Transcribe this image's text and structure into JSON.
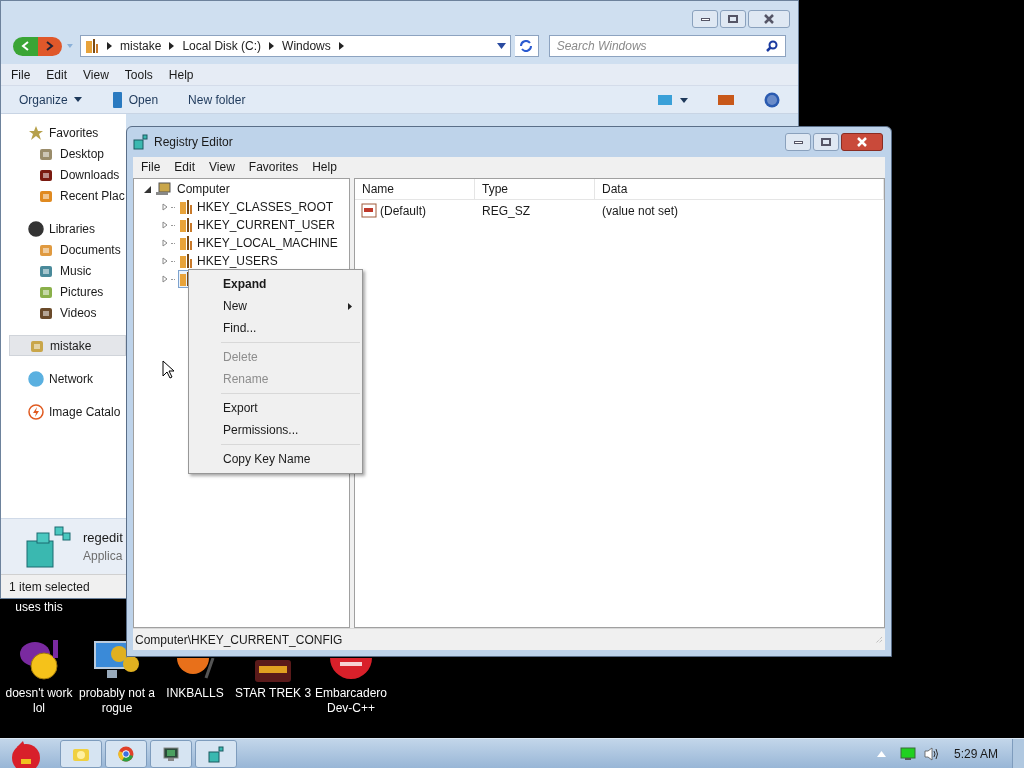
{
  "explorer": {
    "breadcrumb": [
      "mistake",
      "Local Disk (C:)",
      "Windows"
    ],
    "search": {
      "placeholder": "Search Windows"
    },
    "menu": [
      "File",
      "Edit",
      "View",
      "Tools",
      "Help"
    ],
    "toolbar": [
      {
        "label": "Organize",
        "kind": "dropdown"
      },
      {
        "label": "Open",
        "kind": "open"
      },
      {
        "label": "New folder",
        "kind": "plain"
      }
    ],
    "nav": [
      {
        "label": "Favorites",
        "kind": "star",
        "selected": false,
        "children": [
          {
            "label": "Desktop",
            "kind": "desktop"
          },
          {
            "label": "Downloads",
            "kind": "downloads"
          },
          {
            "label": "Recent Plac",
            "kind": "recent"
          }
        ]
      },
      {
        "label": "Libraries",
        "kind": "libraries",
        "selected": false,
        "children": [
          {
            "label": "Documents",
            "kind": "documents"
          },
          {
            "label": "Music",
            "kind": "music"
          },
          {
            "label": "Pictures",
            "kind": "pictures"
          },
          {
            "label": "Videos",
            "kind": "videos"
          }
        ]
      },
      {
        "label": "mistake",
        "kind": "user",
        "selected": true
      },
      {
        "label": "Network",
        "kind": "network",
        "selected": false
      },
      {
        "label": "Image Catalo",
        "kind": "catalog",
        "selected": false
      }
    ],
    "details": {
      "name": "regedit",
      "type": "Applica"
    },
    "status": "1 item selected"
  },
  "registry": {
    "title": "Registry Editor",
    "menu": [
      "File",
      "Edit",
      "View",
      "Favorites",
      "Help"
    ],
    "tree": {
      "label": "Computer",
      "expanded": true,
      "children": [
        {
          "label": "HKEY_CLASSES_ROOT",
          "selected": false
        },
        {
          "label": "HKEY_CURRENT_USER",
          "selected": false
        },
        {
          "label": "HKEY_LOCAL_MACHINE",
          "selected": false
        },
        {
          "label": "HKEY_USERS",
          "selected": false
        },
        {
          "selected": true
        }
      ]
    },
    "columns": [
      "Name",
      "Type",
      "Data"
    ],
    "rows": [
      {
        "name": "(Default)",
        "type": "REG_SZ",
        "data": "(value not set)"
      }
    ],
    "status": "Computer\\HKEY_CURRENT_CONFIG"
  },
  "context_menu": [
    {
      "kind": "item",
      "label": "Expand",
      "default": true,
      "disabled": false
    },
    {
      "kind": "submenu",
      "label": "New",
      "default": false,
      "disabled": false
    },
    {
      "kind": "item",
      "label": "Find...",
      "default": false,
      "disabled": false
    },
    {
      "kind": "separator"
    },
    {
      "kind": "item",
      "label": "Delete",
      "default": false,
      "disabled": true
    },
    {
      "kind": "item",
      "label": "Rename",
      "default": false,
      "disabled": true
    },
    {
      "kind": "separator"
    },
    {
      "kind": "item",
      "label": "Export",
      "default": false,
      "disabled": false
    },
    {
      "kind": "item",
      "label": "Permissions...",
      "default": false,
      "disabled": false
    },
    {
      "kind": "separator"
    },
    {
      "kind": "item",
      "label": "Copy Key Name",
      "default": false,
      "disabled": false
    }
  ],
  "desktop": {
    "partial_label": "uses this",
    "icons": [
      {
        "label": "doesn't work lol",
        "kind": "messenger"
      },
      {
        "label": "probably not a rogue",
        "kind": "gears"
      },
      {
        "label": "INKBALLS",
        "kind": "ball"
      },
      {
        "label": "STAR TREK 3",
        "kind": "game"
      },
      {
        "label": "Embarcadero Dev-C++",
        "kind": "ide"
      }
    ]
  },
  "taskbar": {
    "clock": "5:29 AM"
  }
}
